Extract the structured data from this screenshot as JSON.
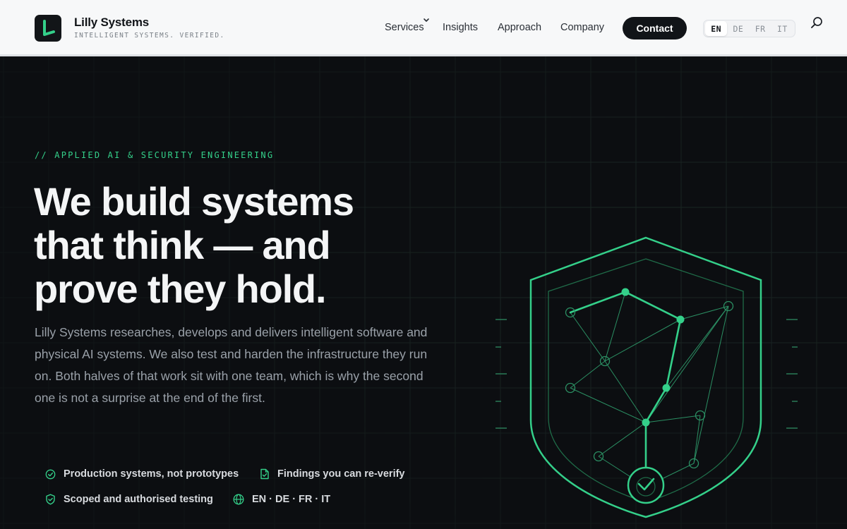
{
  "brand": {
    "name": "Lilly Systems",
    "tagline": "INTELLIGENT SYSTEMS. VERIFIED."
  },
  "nav": {
    "items": [
      {
        "label": "Services",
        "has_dropdown": true
      },
      {
        "label": "Insights"
      },
      {
        "label": "Approach"
      },
      {
        "label": "Company"
      }
    ],
    "contact_label": "Contact",
    "languages": [
      "EN",
      "DE",
      "FR",
      "IT"
    ],
    "active_language": "EN"
  },
  "hero": {
    "eyebrow": "// APPLIED AI & SECURITY ENGINEERING",
    "headline_lines": [
      "We build systems",
      "that think — and",
      "prove they hold."
    ],
    "lead": "Lilly Systems researches, develops and delivers intelligent software and physical AI systems. We also test and harden the infrastructure they run on. Both halves of that work sit with one team, which is why the second one is not a surprise at the end of the first.",
    "features": [
      {
        "icon": "check-circle-icon",
        "label": "Production systems, not prototypes"
      },
      {
        "icon": "document-check-icon",
        "label": "Findings you can re-verify"
      },
      {
        "icon": "shield-check-icon",
        "label": "Scoped and authorised testing"
      },
      {
        "icon": "globe-icon",
        "label": "EN · DE · FR · IT"
      }
    ]
  },
  "colors": {
    "accent": "#34d08a",
    "background": "#0c0e11",
    "header_bg": "#f7f8f9",
    "text_muted": "#9aa1a9"
  }
}
